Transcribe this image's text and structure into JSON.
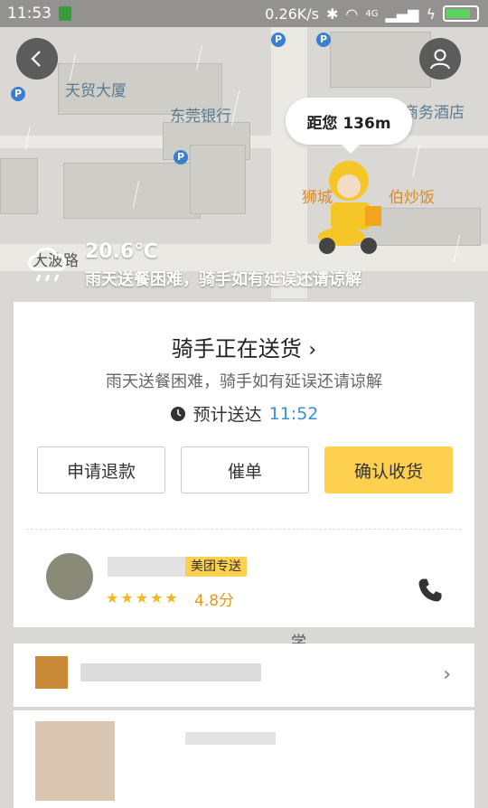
{
  "status_bar": {
    "time": "11:53",
    "network_speed": "0.26K/s",
    "signal_label": "4G",
    "icons": [
      "bluetooth-icon",
      "wifi-icon",
      "signal-icon",
      "charging-icon",
      "battery-icon"
    ]
  },
  "map": {
    "labels": [
      "天贸大厦",
      "东莞银行",
      "狮城",
      "伯炒饭",
      "商务酒店",
      "大波路",
      "学"
    ],
    "distance": "距您 136m"
  },
  "weather": {
    "temperature": "20.6℃",
    "notice": "雨天送餐困难，骑手如有延误还请谅解"
  },
  "status_card": {
    "title": "骑手正在送货",
    "subtitle": "雨天送餐困难，骑手如有延误还请谅解",
    "eta_label": "预计送达",
    "eta_time": "11:52",
    "actions": [
      "申请退款",
      "催单",
      "确认收货"
    ]
  },
  "rider": {
    "badge": "美团专送",
    "rating": "4.8分",
    "stars": "★★★★★"
  },
  "colors": {
    "accent_yellow": "#fdd04f",
    "eta_blue": "#3a8fd6",
    "rating_orange": "#e39a1a"
  }
}
